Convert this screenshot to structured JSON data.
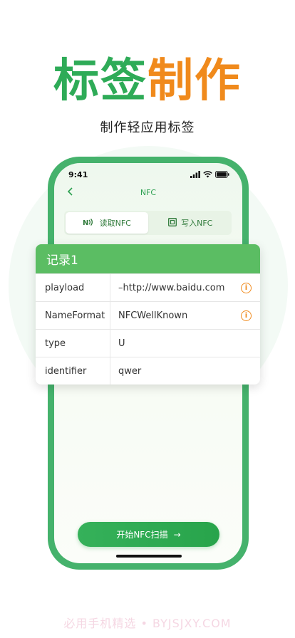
{
  "hero": {
    "title_green": "标签",
    "title_orange": "制作",
    "subtitle": "制作轻应用标签"
  },
  "status_bar": {
    "time": "9:41"
  },
  "nav": {
    "back_icon": "chevron-left-icon",
    "title": "NFC"
  },
  "tabs": [
    {
      "label": "读取NFC",
      "icon": "nfc-icon",
      "active": true
    },
    {
      "label": "写入NFC",
      "icon": "tag-write-icon",
      "active": false
    }
  ],
  "record": {
    "title": "记录1",
    "rows": [
      {
        "key": "playload",
        "value": "–http://www.baidu.com",
        "info": true
      },
      {
        "key": "NameFormat",
        "value": "NFCWellKnown",
        "info": true
      },
      {
        "key": "type",
        "value": "U",
        "info": false
      },
      {
        "key": "identifier",
        "value": "qwer",
        "info": false
      }
    ]
  },
  "scan_button": {
    "label": "开始NFC扫描",
    "arrow": "→"
  },
  "watermark": "必用手机精选 • BYJSJXY.COM",
  "colors": {
    "brand_green": "#2eab57",
    "brand_orange": "#f08a1c",
    "card_header": "#5bbd63",
    "phone_frame": "#45b26c"
  }
}
